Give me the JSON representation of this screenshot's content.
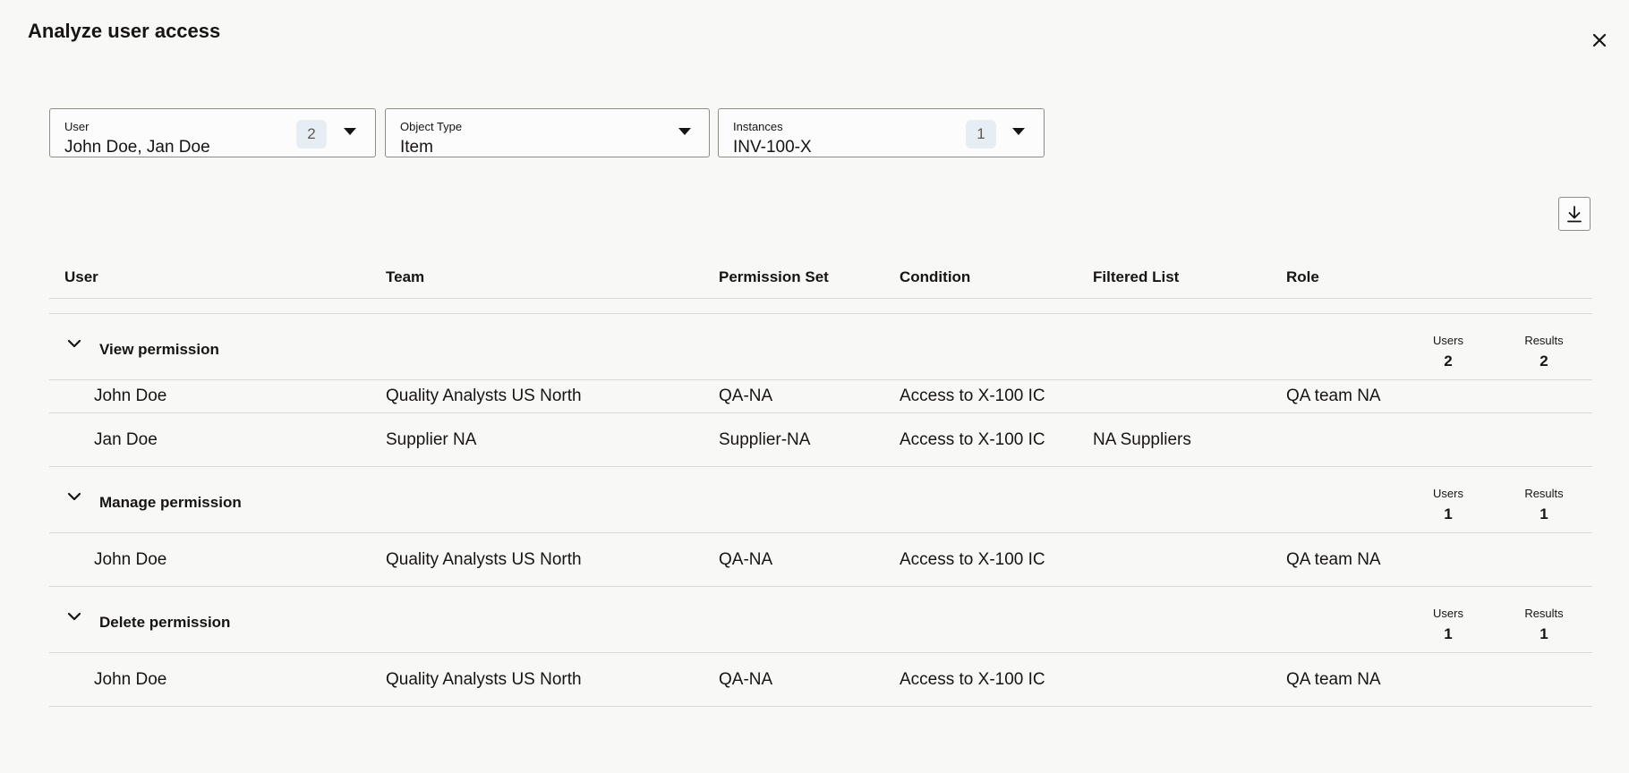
{
  "dialog": {
    "title": "Analyze user access"
  },
  "filters": {
    "user": {
      "label": "User",
      "value": "John Doe, Jan Doe",
      "count": "2"
    },
    "object_type": {
      "label": "Object Type",
      "value": "Item"
    },
    "instances": {
      "label": "Instances",
      "value": "INV-100-X",
      "count": "1"
    }
  },
  "table": {
    "columns": [
      "User",
      "Team",
      "Permission Set",
      "Condition",
      "Filtered List",
      "Role"
    ],
    "stat_labels": {
      "users": "Users",
      "results": "Results"
    },
    "groups": [
      {
        "title": "View permission",
        "users": "2",
        "results": "2",
        "rows": [
          {
            "user": "John Doe",
            "team": "Quality Analysts US North",
            "permission_set": "QA-NA",
            "condition": "Access to X-100 IC",
            "filtered_list": "",
            "role": "QA team NA"
          },
          {
            "user": "Jan Doe",
            "team": "Supplier NA",
            "permission_set": "Supplier-NA",
            "condition": "Access to X-100 IC",
            "filtered_list": "NA Suppliers",
            "role": ""
          }
        ]
      },
      {
        "title": "Manage permission",
        "users": "1",
        "results": "1",
        "rows": [
          {
            "user": "John Doe",
            "team": "Quality Analysts US North",
            "permission_set": "QA-NA",
            "condition": "Access to X-100 IC",
            "filtered_list": "",
            "role": "QA team NA"
          }
        ]
      },
      {
        "title": "Delete permission",
        "users": "1",
        "results": "1",
        "rows": [
          {
            "user": "John Doe",
            "team": "Quality Analysts US North",
            "permission_set": "QA-NA",
            "condition": "Access to X-100 IC",
            "filtered_list": "",
            "role": "QA team NA"
          }
        ]
      }
    ]
  },
  "icons": {
    "close": "close-icon",
    "download": "download-icon",
    "dropdown": "caret-down-icon",
    "collapse": "chevron-down-icon"
  }
}
